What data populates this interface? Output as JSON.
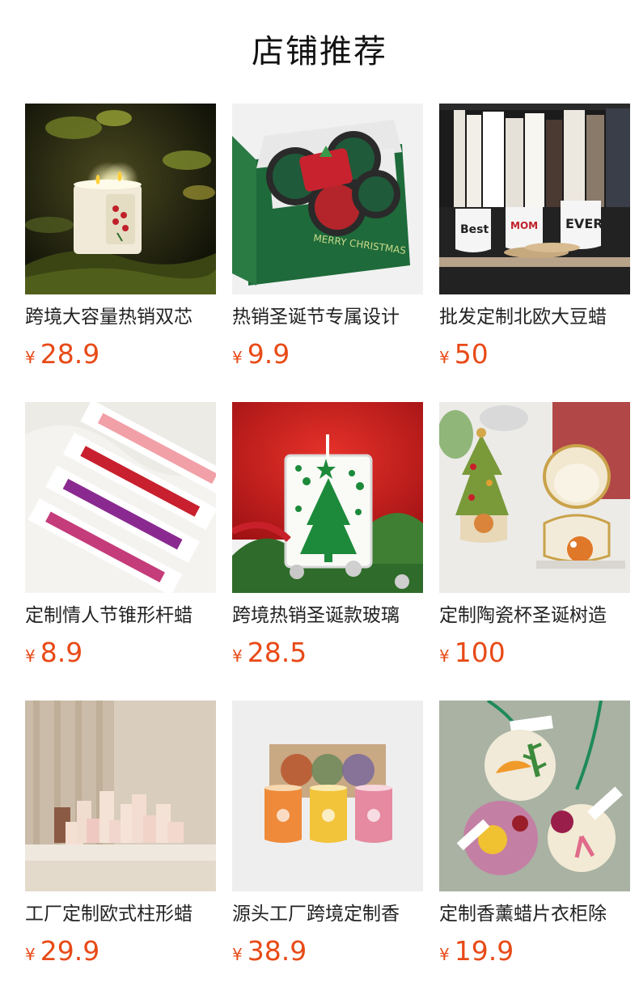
{
  "header": {
    "title": "店铺推荐"
  },
  "currency": "¥",
  "products": [
    {
      "name": "跨境大容量热销双芯",
      "price": "28.9",
      "image": "candle-jar-forest"
    },
    {
      "name": "热销圣诞节专属设计",
      "price": "9.9",
      "image": "christmas-tin-gift-box"
    },
    {
      "name": "批发定制北欧大豆蜡",
      "price": "50",
      "image": "candle-jars-bookshelf"
    },
    {
      "name": "定制情人节锥形杆蜡",
      "price": "8.9",
      "image": "taper-candle-boxes"
    },
    {
      "name": "跨境热销圣诞款玻璃",
      "price": "28.5",
      "image": "christmas-tree-glass-candle"
    },
    {
      "name": "定制陶瓷杯圣诞树造",
      "price": "100",
      "image": "ceramic-christmas-tree-candle"
    },
    {
      "name": "工厂定制欧式柱形蜡",
      "price": "29.9",
      "image": "pillar-candles"
    },
    {
      "name": "源头工厂跨境定制香",
      "price": "38.9",
      "image": "scented-candle-gift-set"
    },
    {
      "name": "定制香薰蜡片衣柜除",
      "price": "19.9",
      "image": "aroma-wax-tablets"
    }
  ]
}
